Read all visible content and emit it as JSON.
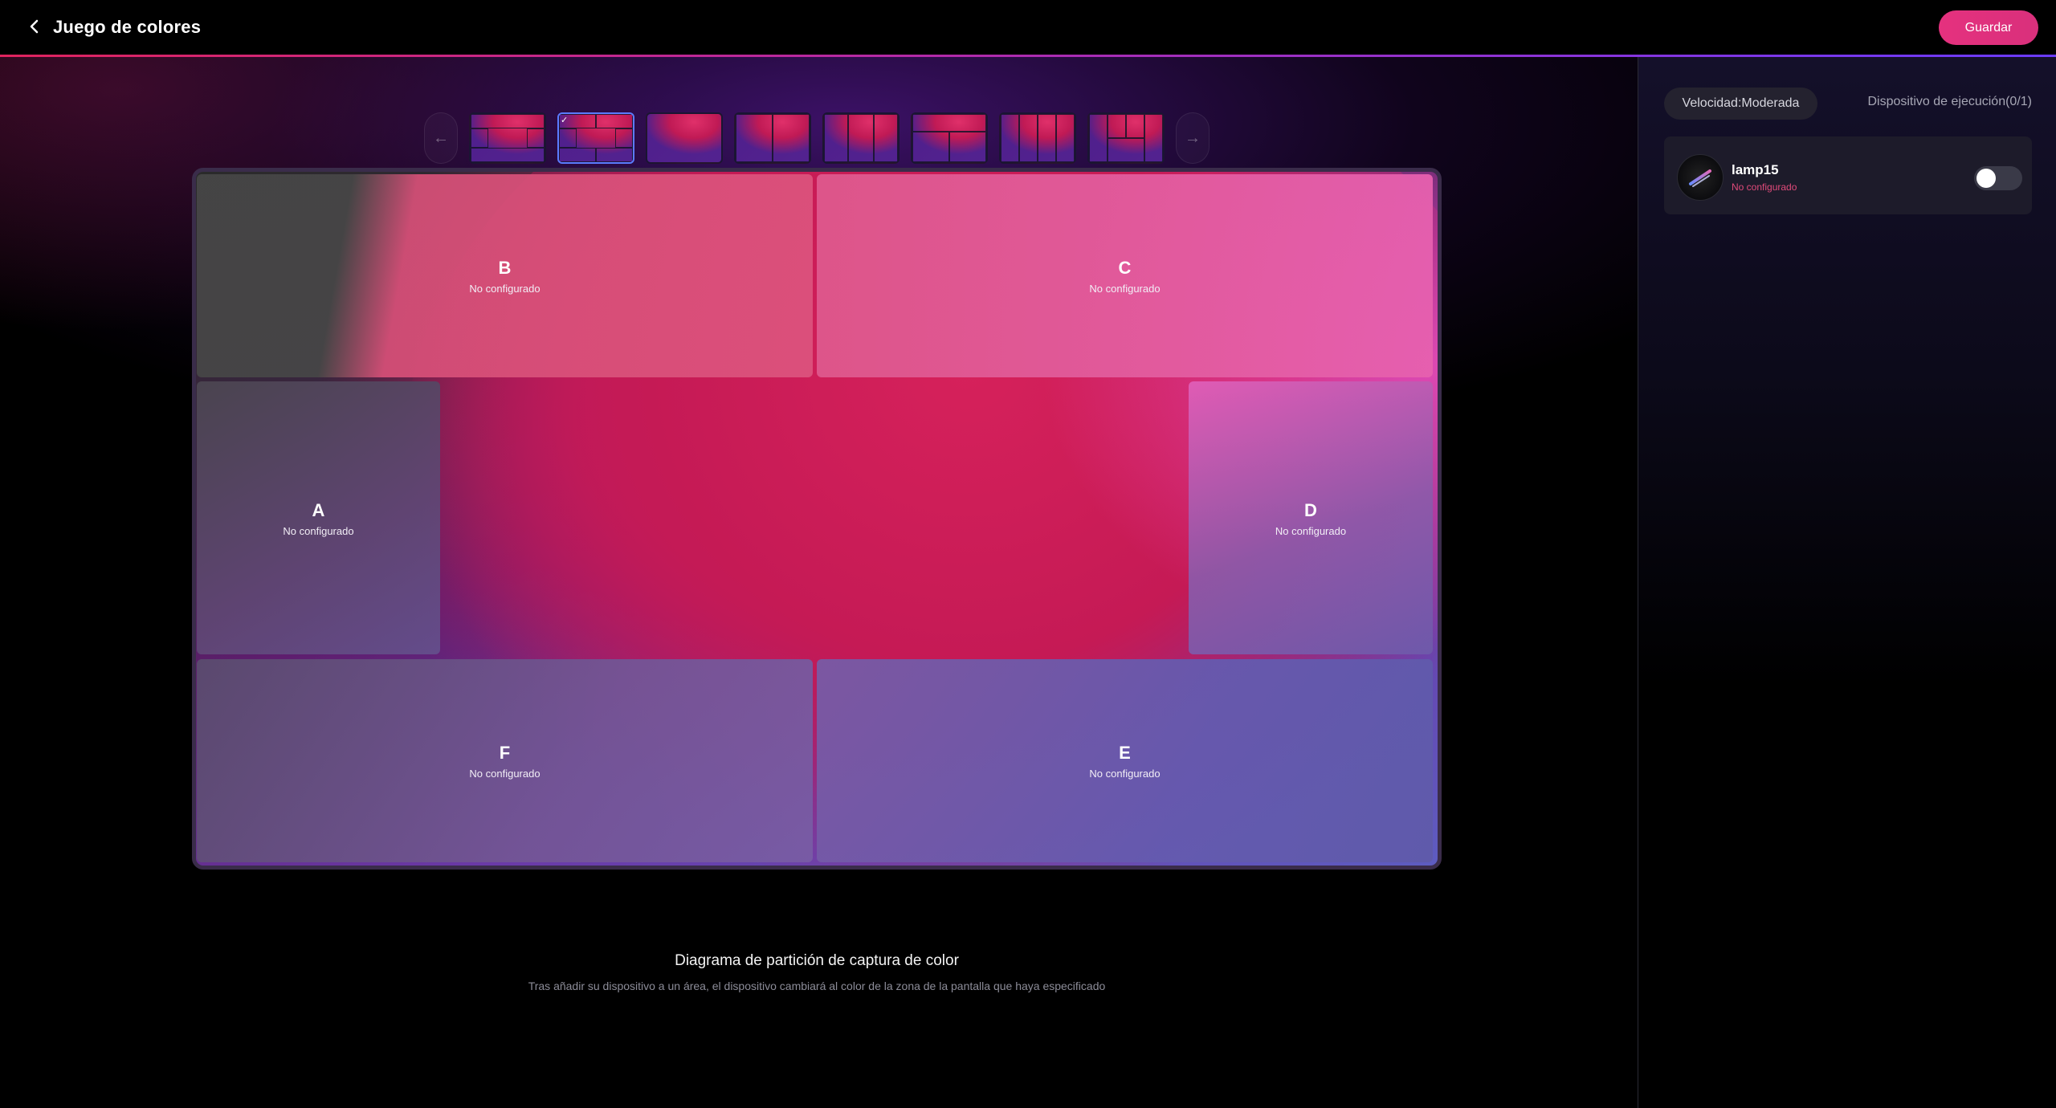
{
  "header": {
    "title": "Juego de colores",
    "save_label": "Guardar"
  },
  "carousel": {
    "prev_arrow": "←",
    "next_arrow": "→",
    "layouts": [
      {
        "name": "layout-1",
        "selected": false
      },
      {
        "name": "layout-2",
        "selected": true,
        "check": "✓"
      },
      {
        "name": "layout-3",
        "selected": false
      },
      {
        "name": "layout-4",
        "selected": false
      },
      {
        "name": "layout-5",
        "selected": false
      },
      {
        "name": "layout-6",
        "selected": false
      },
      {
        "name": "layout-7",
        "selected": false
      },
      {
        "name": "layout-8",
        "selected": false
      }
    ]
  },
  "zones": {
    "b": {
      "letter": "B",
      "status": "No configurado"
    },
    "c": {
      "letter": "C",
      "status": "No configurado"
    },
    "a": {
      "letter": "A",
      "status": "No configurado"
    },
    "d": {
      "letter": "D",
      "status": "No configurado"
    },
    "f": {
      "letter": "F",
      "status": "No configurado"
    },
    "e": {
      "letter": "E",
      "status": "No configurado"
    }
  },
  "caption": {
    "title": "Diagrama de partición de captura de color",
    "subtitle": "Tras añadir su dispositivo a un área, el dispositivo cambiará al color de la zona de la pantalla que haya especificado"
  },
  "panel": {
    "speed_label": "Velocidad:Moderada",
    "device_count": "Dispositivo de ejecución(0/1)",
    "device": {
      "name": "lamp15",
      "status": "No configurado",
      "enabled": false
    }
  },
  "colors": {
    "accent": "#e5317e",
    "selected_border": "#5b7cff",
    "status_red": "#e04a7a"
  }
}
